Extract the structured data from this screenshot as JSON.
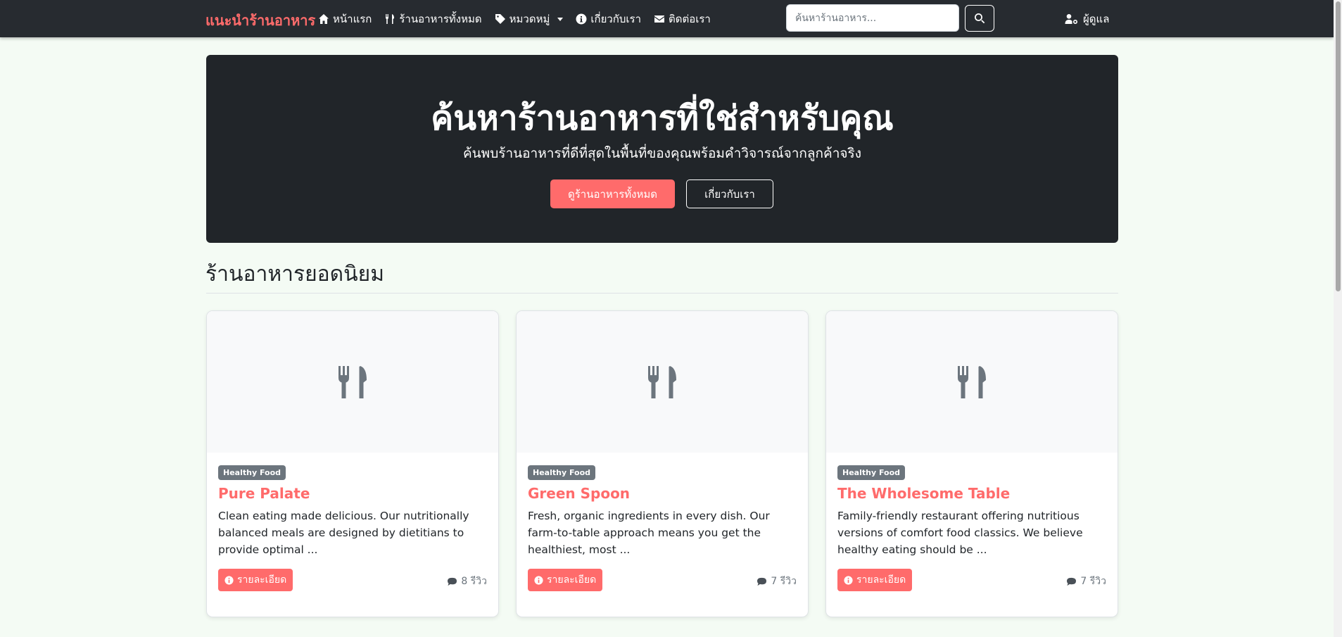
{
  "navbar": {
    "brand": "แนะนำร้านอาหาร",
    "items": [
      {
        "label": "หน้าแรก",
        "icon": "home-icon"
      },
      {
        "label": "ร้านอาหารทั้งหมด",
        "icon": "utensils-icon"
      },
      {
        "label": "หมวดหมู่",
        "icon": "tag-icon",
        "dropdown": true
      },
      {
        "label": "เกี่ยวกับเรา",
        "icon": "info-icon"
      },
      {
        "label": "ติดต่อเรา",
        "icon": "envelope-icon"
      }
    ],
    "search_placeholder": "ค้นหาร้านอาหาร...",
    "search_value": "",
    "admin_label": "ผู้ดูแล"
  },
  "hero": {
    "title": "ค้นหาร้านอาหารที่ใช่สำหรับคุณ",
    "subtitle": "ค้นพบร้านอาหารที่ดีที่สุดในพื้นที่ของคุณพร้อมคำวิจารณ์จากลูกค้าจริง",
    "primary_button": "ดูร้านอาหารทั้งหมด",
    "outline_button": "เกี่ยวกับเรา"
  },
  "popular": {
    "title": "ร้านอาหารยอดนิยม",
    "cards": [
      {
        "category": "Healthy Food",
        "name": "Pure Palate",
        "description": "Clean eating made delicious. Our nutritionally balanced meals are designed by dietitians to provide optimal ...",
        "detail_button": "รายละเอียด",
        "reviews": "8 รีวิว"
      },
      {
        "category": "Healthy Food",
        "name": "Green Spoon",
        "description": "Fresh, organic ingredients in every dish. Our farm-to-table approach means you get the healthiest, most ...",
        "detail_button": "รายละเอียด",
        "reviews": "7 รีวิว"
      },
      {
        "category": "Healthy Food",
        "name": "The Wholesome Table",
        "description": "Family-friendly restaurant offering nutritious versions of comfort food classics. We believe healthy eating should be ...",
        "detail_button": "รายละเอียด",
        "reviews": "7 รีวิว"
      }
    ]
  },
  "colors": {
    "brand": "#ff6b6b",
    "navbar_bg": "#272b30",
    "hero_bg": "#212529",
    "page_bg": "#f4fbf4",
    "badge_bg": "#6c757d"
  }
}
